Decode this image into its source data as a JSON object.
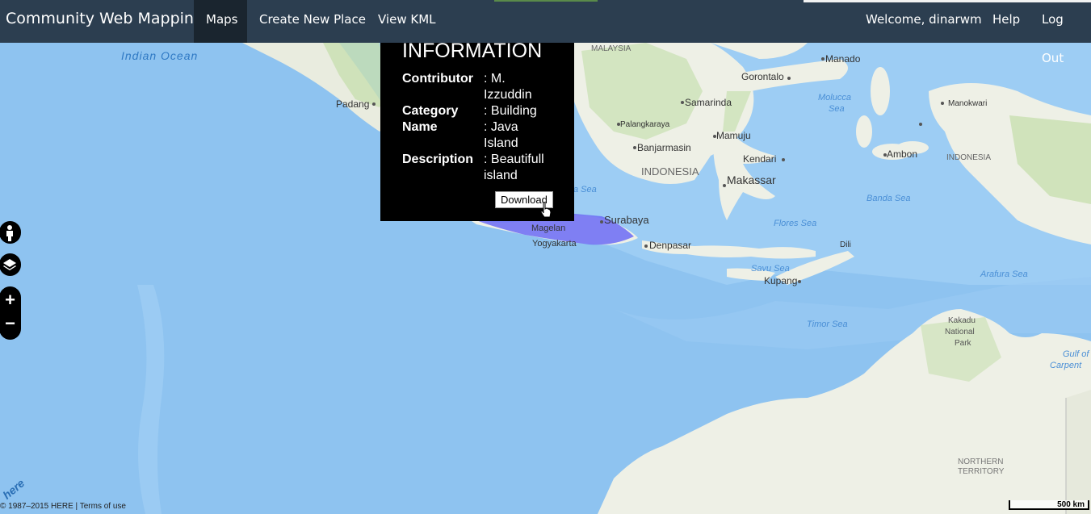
{
  "navbar": {
    "brand": "Community Web Mapping",
    "left_items": [
      {
        "label": "Maps",
        "active": true
      },
      {
        "label": "Create New Place"
      },
      {
        "label": "View KML"
      }
    ],
    "right_items": [
      {
        "label": "Welcome, dinarwm"
      },
      {
        "label": "Help"
      },
      {
        "label": "Log Out"
      }
    ]
  },
  "popup": {
    "title": "INFORMATION",
    "rows": [
      {
        "key": "Contributor",
        "value": ": M. Izzuddin"
      },
      {
        "key": "Category",
        "value": ": Building"
      },
      {
        "key": "Name",
        "value": ": Java Island"
      },
      {
        "key": "Description",
        "value": ": Beautifull island"
      }
    ],
    "download_label": "Download"
  },
  "map": {
    "labels": {
      "indian_ocean": "Indian Ocean",
      "malaysia": "MALAYSIA",
      "manado": "Manado",
      "gorontalo": "Gorontalo",
      "padang": "Padang",
      "samarinda": "Samarinda",
      "molucca_sea": "Molucca",
      "molucca_sea2": "Sea",
      "manokwari": "Manokwari",
      "palangkaraya": "Palangkaraya",
      "mamuju": "Mamuju",
      "banjarmasin": "Banjarmasin",
      "kendari": "Kendari",
      "ambon": "Ambon",
      "indonesia": "INDONESIA",
      "indonesia2": "INDONESIA",
      "makassar": "Makassar",
      "java_sea": "a Sea",
      "banda_sea": "Banda Sea",
      "surabaya": "Surabaya",
      "magelang": "Magelan",
      "yogyakarta": "Yogyakarta",
      "flores_sea": "Flores Sea",
      "denpasar": "Denpasar",
      "dili": "Dili",
      "savu_sea": "Savu Sea",
      "kupang": "Kupang",
      "arafura_sea": "Arafura Sea",
      "timor_sea": "Timor Sea",
      "kakadu1": "Kakadu",
      "kakadu2": "National",
      "kakadu3": "Park",
      "gulf1": "Gulf of",
      "gulf2": "Carpent",
      "nt1": "NORTHERN",
      "nt2": "TERRITORY"
    },
    "controls": {
      "pegman": "person-icon",
      "layers": "layers-icon",
      "zoom_in": "+",
      "zoom_out": "−"
    },
    "attribution": "© 1987–2015 HERE | Terms of use",
    "scale_label": "500 km",
    "logo_text": "here"
  },
  "colors": {
    "navbar": "#2c3e50",
    "navbar_active": "#1a252f",
    "water": "#8ec3f0",
    "land": "#eef0e6",
    "land_green": "#c8e0b0",
    "polygon": "#6b6bf5"
  }
}
